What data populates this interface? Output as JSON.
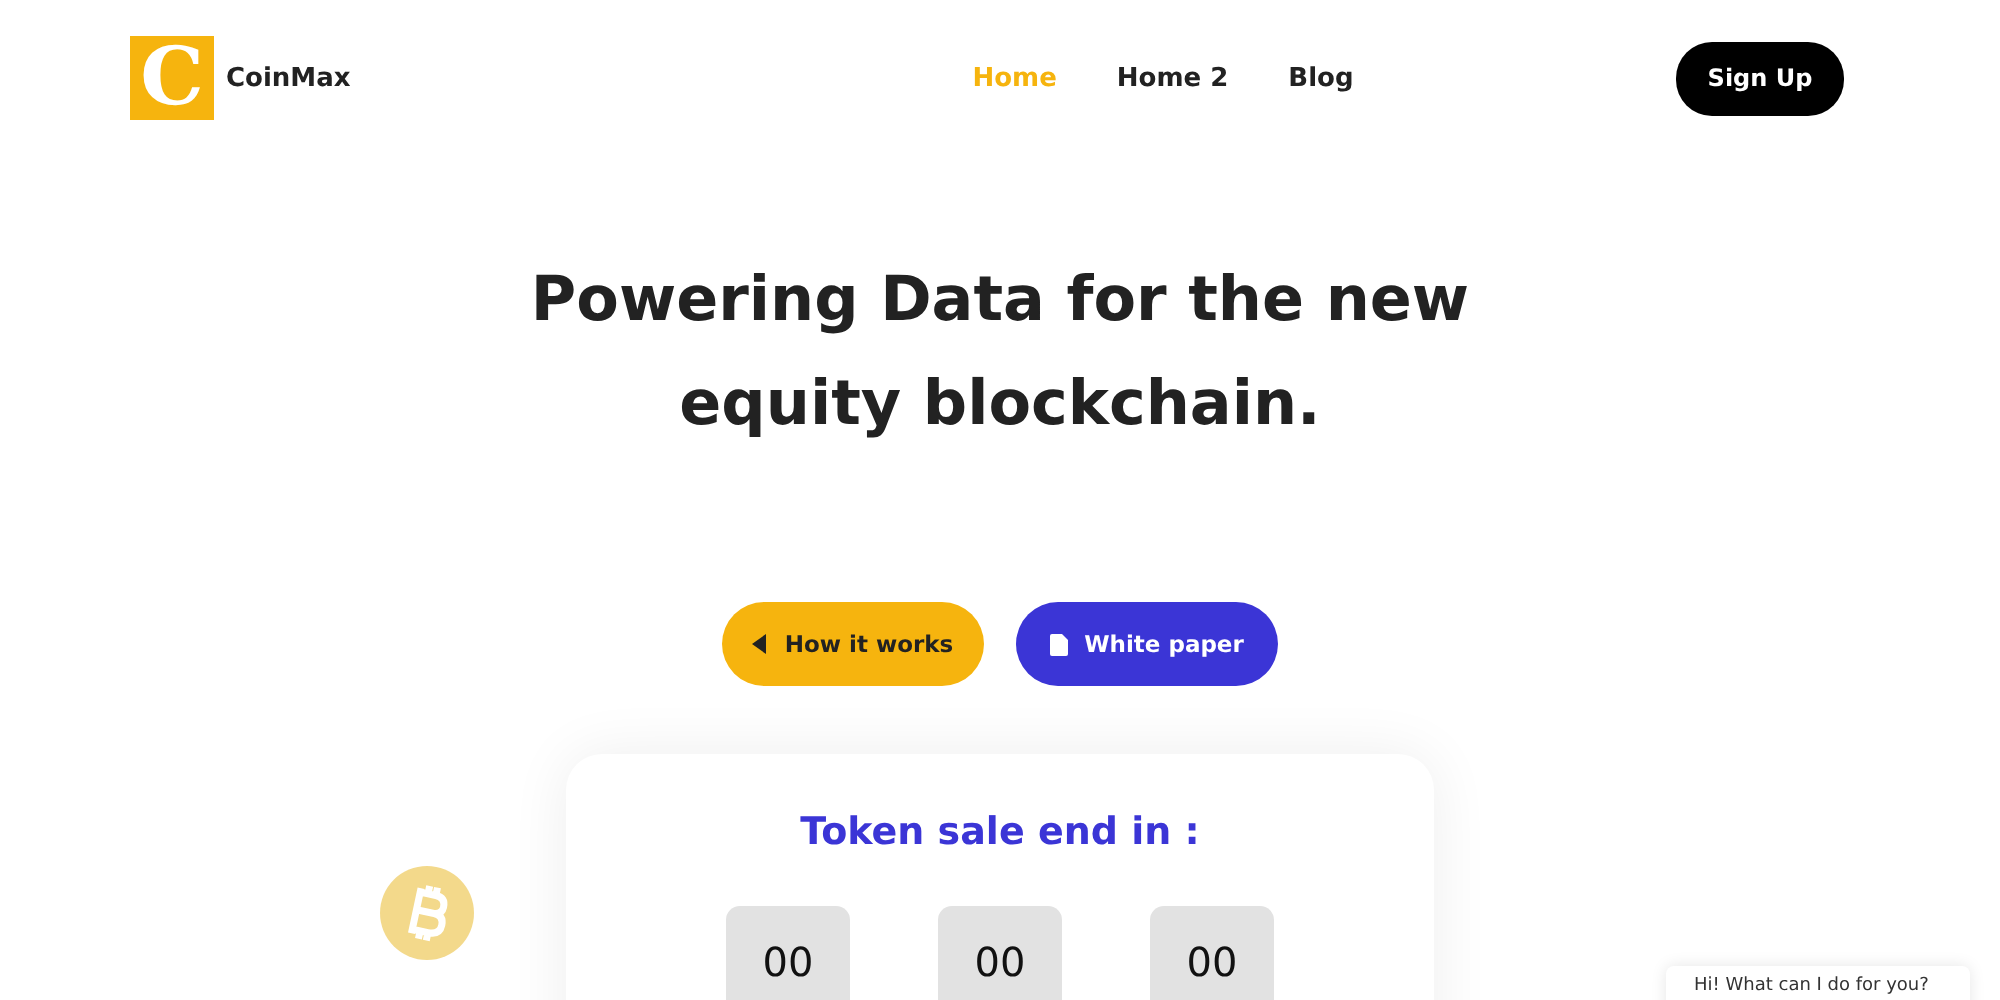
{
  "logo": {
    "letter": "C",
    "name": "CoinMax"
  },
  "nav": [
    {
      "label": "Home",
      "selected": true
    },
    {
      "label": "Home 2",
      "selected": false
    },
    {
      "label": "Blog",
      "selected": false
    }
  ],
  "signup": "Sign Up",
  "hero": {
    "title_lines": [
      "Powering Data for the new",
      "equity blockchain."
    ]
  },
  "buttons": [
    {
      "kind": "video",
      "label": "How it works"
    },
    {
      "kind": "document",
      "label": "White paper"
    }
  ],
  "countdown": {
    "title": "Token sale end in :",
    "units": [
      "00",
      "00",
      "00"
    ]
  },
  "chat": {
    "message": "Hi! What can I do for you?"
  }
}
